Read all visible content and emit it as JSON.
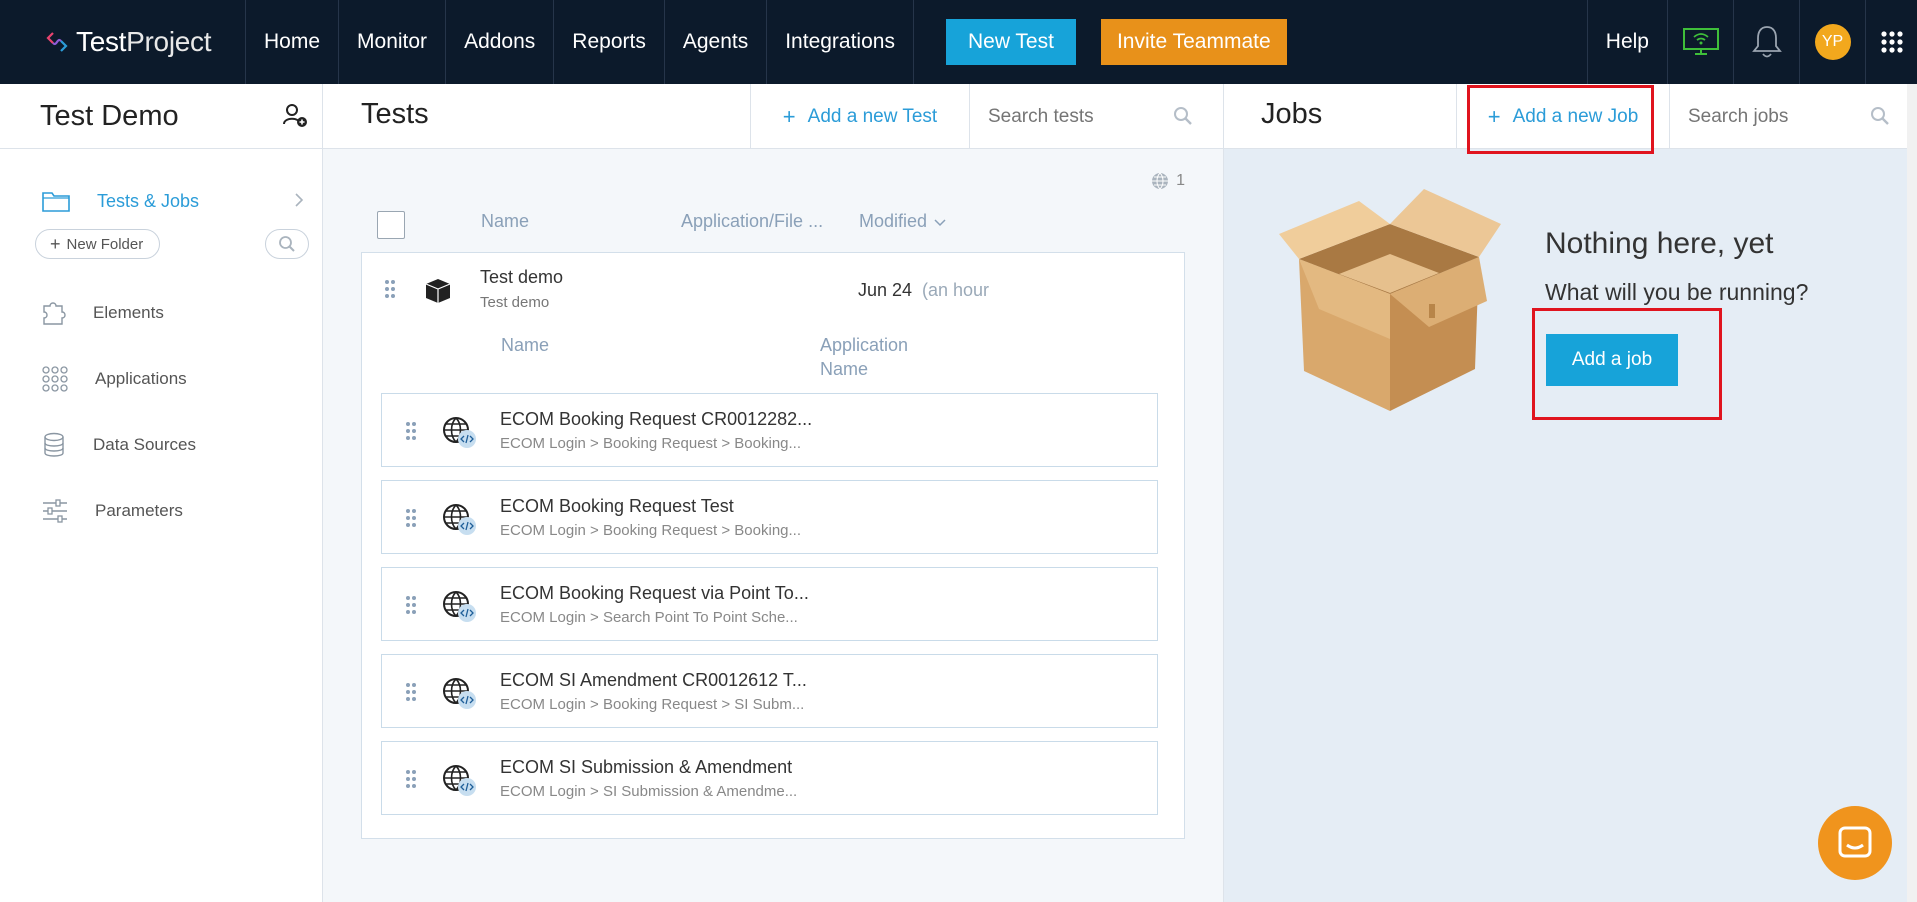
{
  "brand": {
    "logo_bold": "Test",
    "logo_thin": "Project"
  },
  "nav": {
    "items": [
      {
        "label": "Home"
      },
      {
        "label": "Monitor"
      },
      {
        "label": "Addons"
      },
      {
        "label": "Reports"
      },
      {
        "label": "Agents"
      },
      {
        "label": "Integrations"
      }
    ],
    "new_test": "New Test",
    "invite": "Invite Teammate",
    "help": "Help",
    "avatar_initials": "YP"
  },
  "sidebar": {
    "project_title": "Test Demo",
    "tree_label": "Tests & Jobs",
    "new_folder": "New Folder",
    "links": [
      {
        "label": "Elements"
      },
      {
        "label": "Applications"
      },
      {
        "label": "Data Sources"
      },
      {
        "label": "Parameters"
      }
    ]
  },
  "tests": {
    "title": "Tests",
    "add_label": "Add a new Test",
    "search_placeholder": "Search tests",
    "web_count": "1",
    "columns": {
      "name": "Name",
      "app": "Application/File ...",
      "modified": "Modified"
    },
    "test": {
      "name": "Test demo",
      "description": "Test demo",
      "date": "Jun 24",
      "relative": "(an hour"
    },
    "sub_columns": {
      "name": "Name",
      "app_line1": "Application",
      "app_line2": "Name"
    },
    "steps": [
      {
        "name": "ECOM Booking Request CR0012282...",
        "path": "ECOM Login > Booking Request > Booking..."
      },
      {
        "name": "ECOM Booking Request Test",
        "path": "ECOM Login > Booking Request > Booking..."
      },
      {
        "name": "ECOM Booking Request via Point To...",
        "path": "ECOM Login > Search Point To Point Sche..."
      },
      {
        "name": "ECOM SI Amendment CR0012612 T...",
        "path": "ECOM Login > Booking Request > SI Subm..."
      },
      {
        "name": "ECOM SI Submission & Amendment",
        "path": "ECOM Login > SI Submission & Amendme..."
      }
    ]
  },
  "jobs": {
    "title": "Jobs",
    "add_label": "Add a new Job",
    "search_placeholder": "Search jobs",
    "empty_title": "Nothing here, yet",
    "empty_subtitle": "What will you be running?",
    "add_button": "Add a job"
  },
  "colors": {
    "accent": "#17a3d9",
    "invite": "#e8911a",
    "nav_bg": "#0c1a2b",
    "highlight": "#e0141e"
  }
}
